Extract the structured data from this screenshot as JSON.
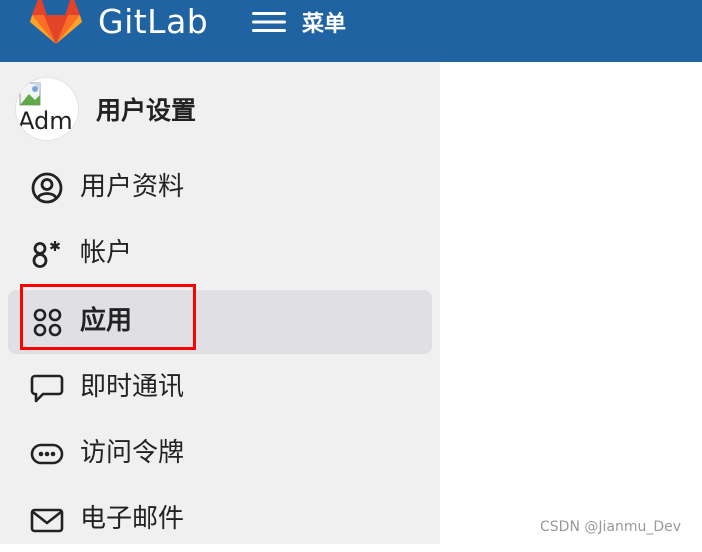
{
  "topbar": {
    "brand": "GitLab",
    "menu_label": "菜单",
    "background": "#1f63a3"
  },
  "sidebar": {
    "avatar_alt": "Adm",
    "title": "用户设置",
    "items": [
      {
        "label": "用户资料",
        "icon": "user-circle-icon"
      },
      {
        "label": "帐户",
        "icon": "account-settings-icon"
      },
      {
        "label": "应用",
        "icon": "applications-grid-icon",
        "active": true
      },
      {
        "label": "即时通讯",
        "icon": "chat-bubble-icon"
      },
      {
        "label": "访问令牌",
        "icon": "token-icon"
      },
      {
        "label": "电子邮件",
        "icon": "envelope-icon"
      }
    ]
  },
  "annotation": {
    "highlight_color": "#ff0000"
  },
  "watermark": "CSDN @Jianmu_Dev"
}
